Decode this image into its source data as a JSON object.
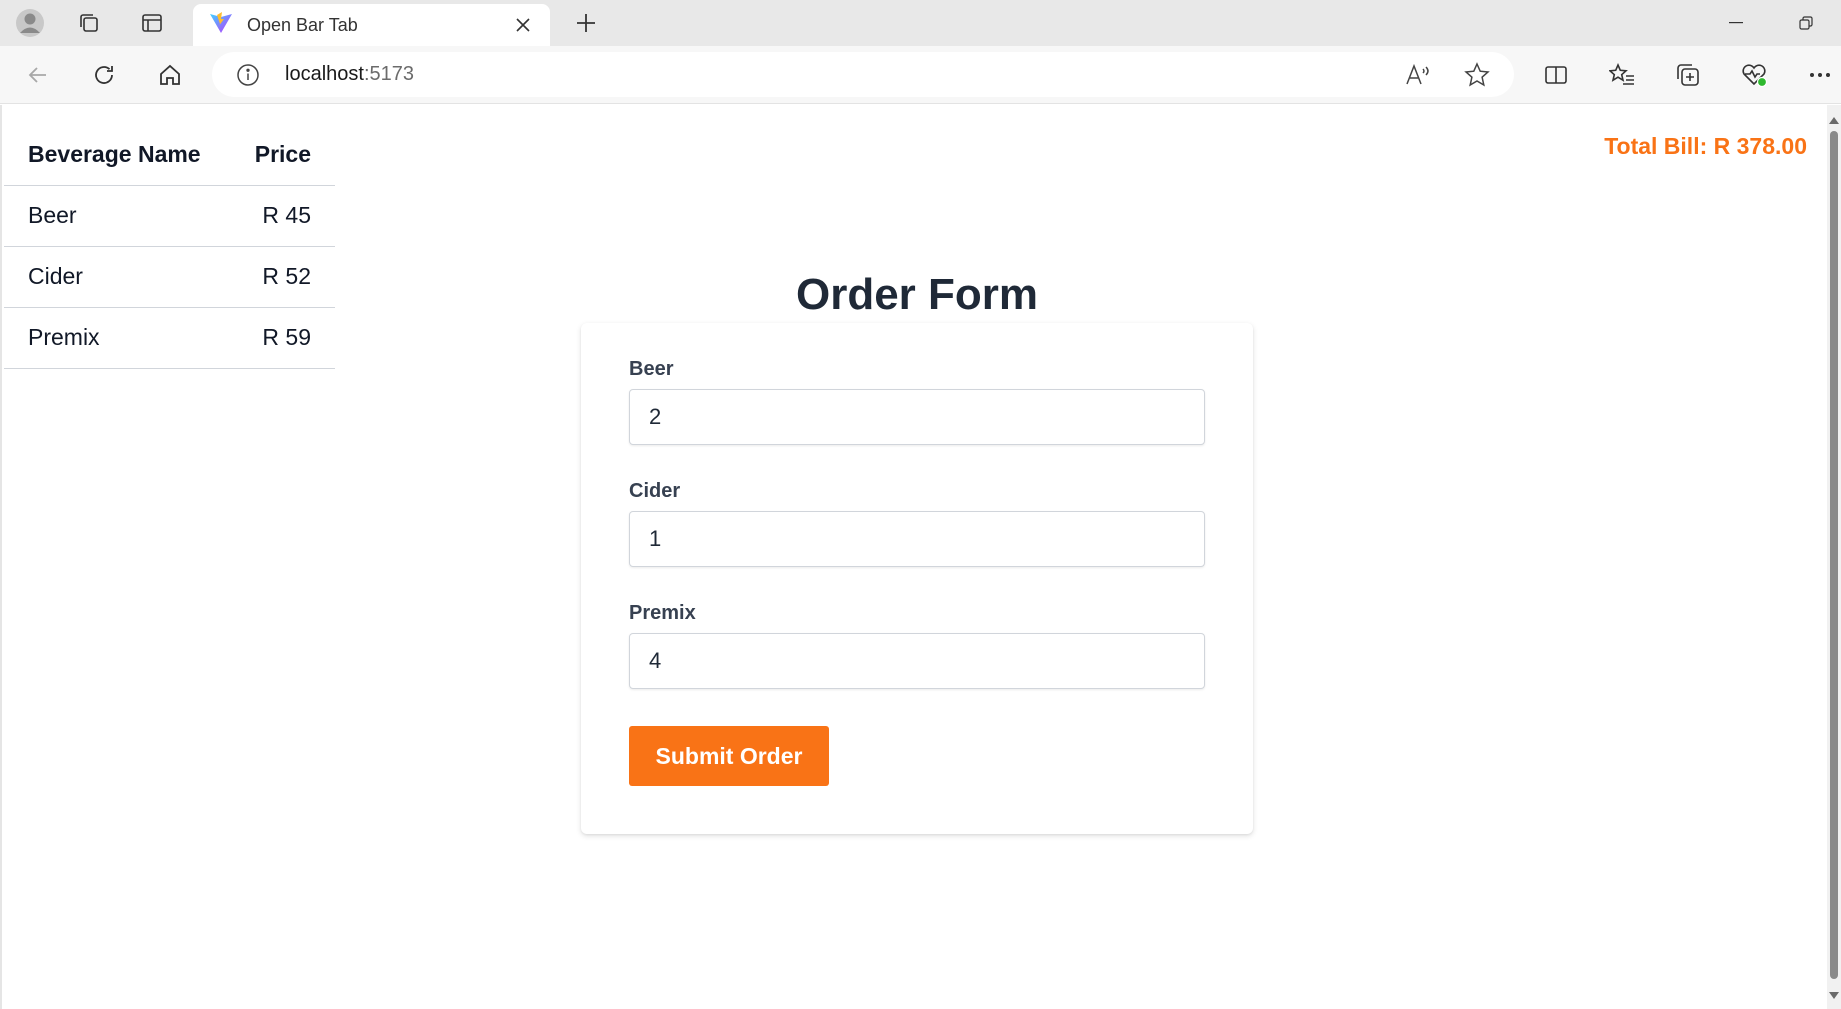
{
  "browser": {
    "tab_title": "Open Bar Tab",
    "address": {
      "host": "localhost",
      "port": ":5173"
    }
  },
  "price_table": {
    "headers": [
      "Beverage Name",
      "Price"
    ],
    "rows": [
      {
        "name": "Beer",
        "price": "R 45"
      },
      {
        "name": "Cider",
        "price": "R 52"
      },
      {
        "name": "Premix",
        "price": "R 59"
      }
    ]
  },
  "total_bill": "Total Bill: R 378.00",
  "order_form": {
    "title": "Order Form",
    "fields": [
      {
        "label": "Beer",
        "value": "2"
      },
      {
        "label": "Cider",
        "value": "1"
      },
      {
        "label": "Premix",
        "value": "4"
      }
    ],
    "submit_label": "Submit Order"
  },
  "colors": {
    "accent": "#f97316",
    "text": "#1f2937"
  }
}
